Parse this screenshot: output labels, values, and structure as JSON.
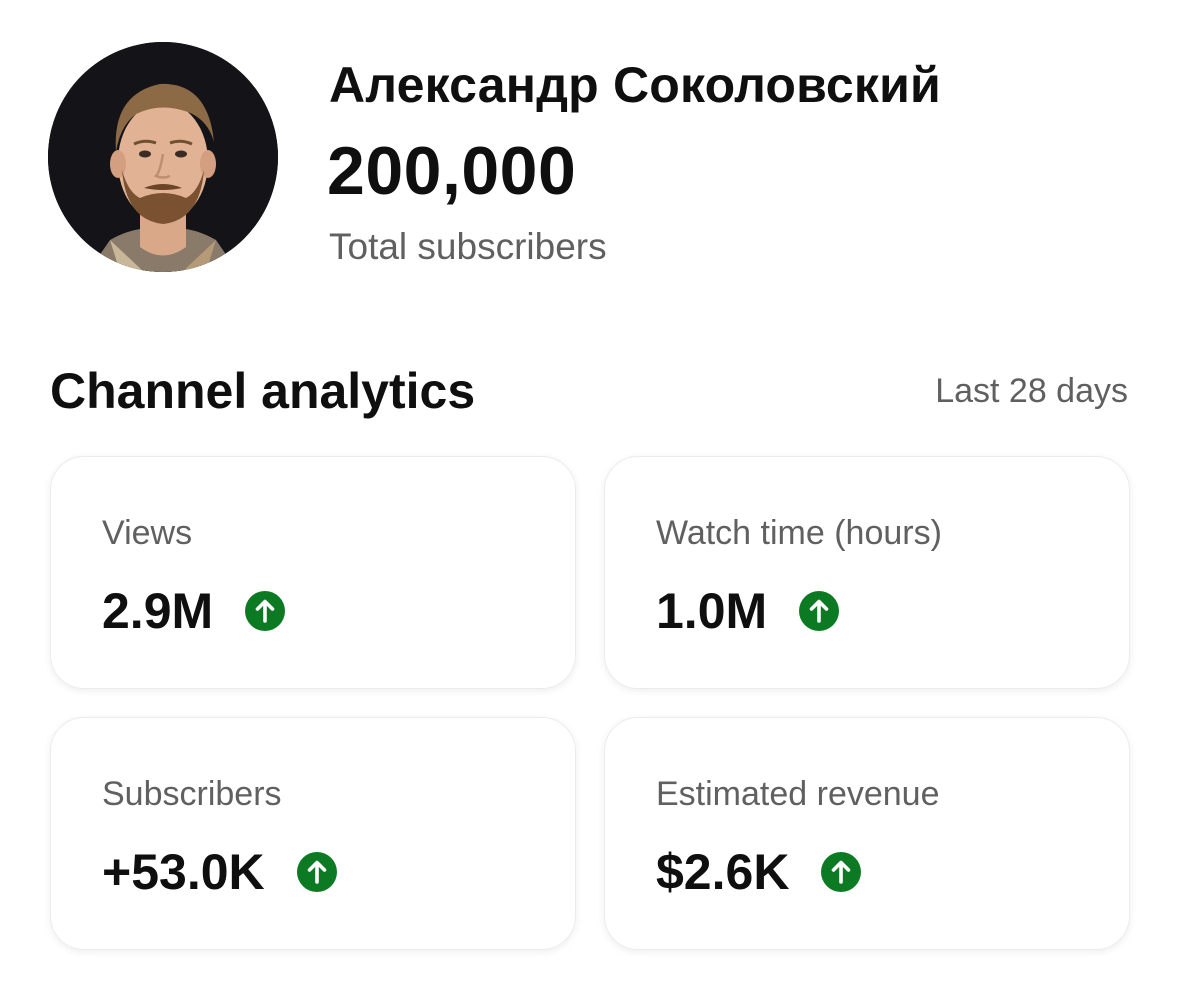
{
  "profile": {
    "name": "Александр Соколовский",
    "subscriber_count": "200,000",
    "subscriber_label": "Total subscribers",
    "avatar_icon": "avatar-photo"
  },
  "analytics": {
    "title": "Channel analytics",
    "period": "Last 28 days",
    "trend_color": "#0b7a22",
    "cards": [
      {
        "label": "Views",
        "value": "2.9M",
        "trend": "up",
        "icon": "arrow-up-circle-icon"
      },
      {
        "label": "Watch time (hours)",
        "value": "1.0M",
        "trend": "up",
        "icon": "arrow-up-circle-icon"
      },
      {
        "label": "Subscribers",
        "value": "+53.0K",
        "trend": "up",
        "icon": "arrow-up-circle-icon"
      },
      {
        "label": "Estimated revenue",
        "value": "$2.6K",
        "trend": "up",
        "icon": "arrow-up-circle-icon"
      }
    ]
  }
}
